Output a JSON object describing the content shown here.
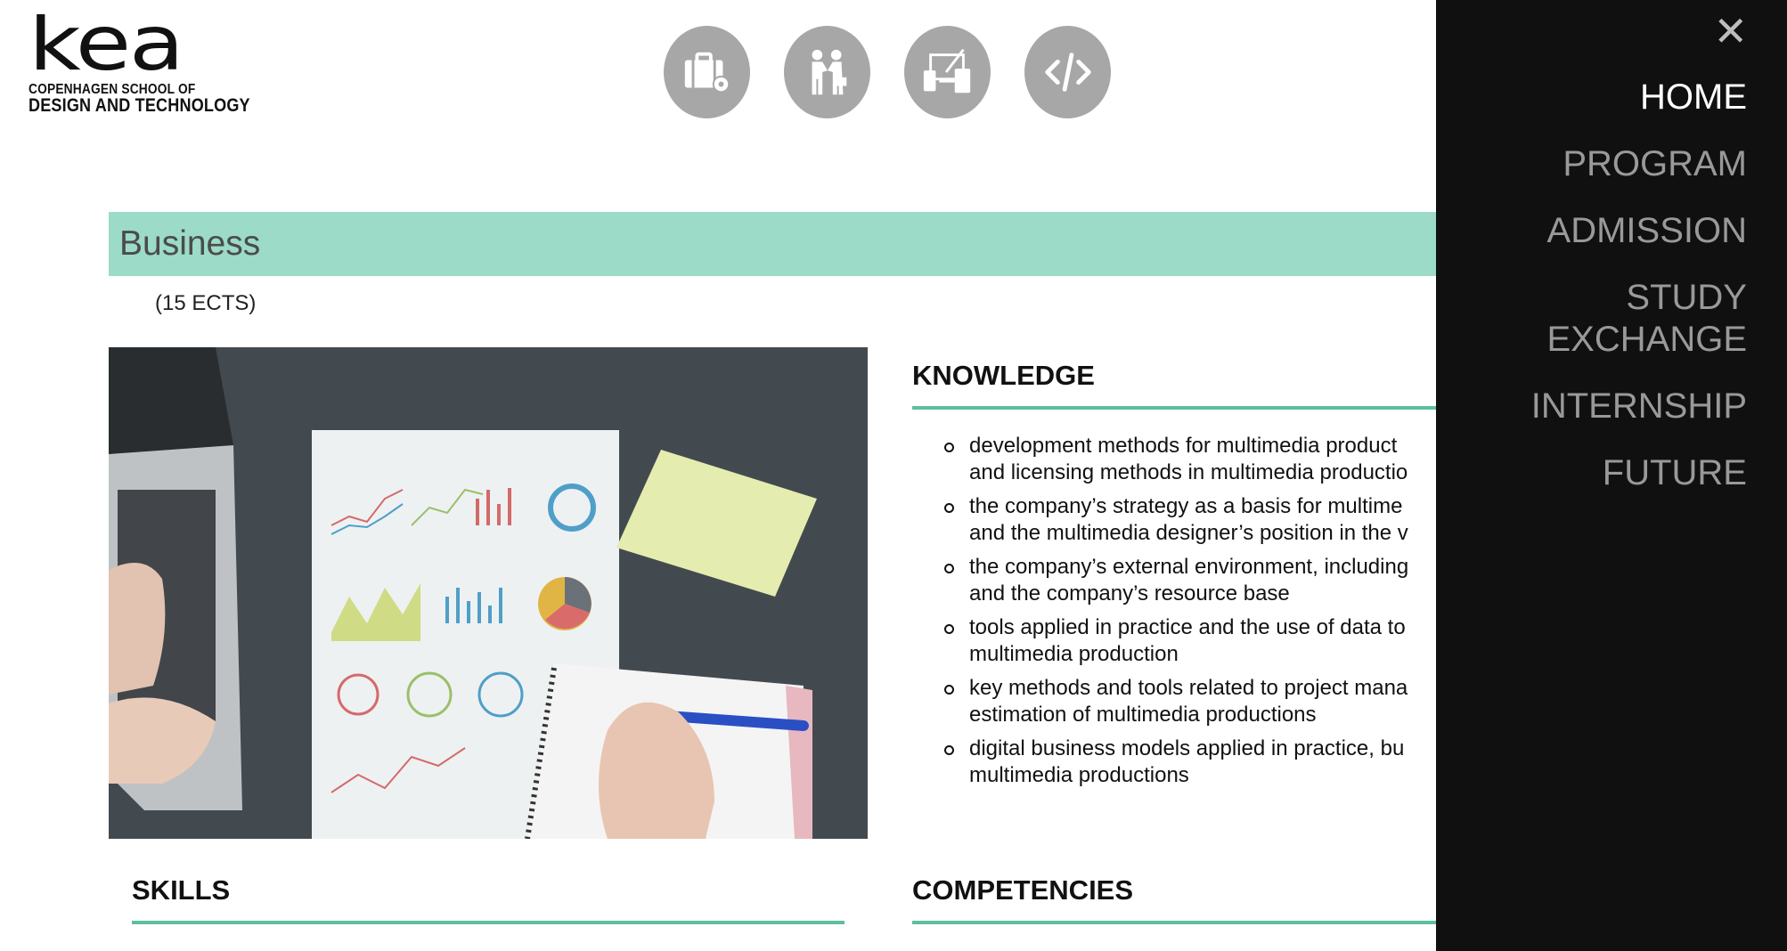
{
  "logo": {
    "word": "kea",
    "line1": "COPENHAGEN SCHOOL OF",
    "line2": "DESIGN AND TECHNOLOGY"
  },
  "top_icons": [
    {
      "name": "business-briefcase-icon"
    },
    {
      "name": "handshake-icon"
    },
    {
      "name": "multimedia-devices-icon"
    },
    {
      "name": "code-icon"
    }
  ],
  "page": {
    "title": "Business",
    "ects": "(15 ECTS)"
  },
  "knowledge": {
    "heading": "KNOWLEDGE",
    "items": [
      "development methods for multimedia product\nand licensing methods in multimedia productio",
      "the company’s strategy as a basis for multime\nand the multimedia designer’s position in the v",
      "the company’s external environment, including\nand the company’s resource base",
      "tools applied in practice and the use of data to\nmultimedia production",
      "key methods and tools related to project mana\nestimation of multimedia productions",
      "digital business models applied in practice, bu\nmultimedia productions"
    ]
  },
  "skills": {
    "heading": "SKILLS"
  },
  "competencies": {
    "heading": "COMPETENCIES"
  },
  "menu": {
    "close_label": "✕",
    "items": [
      "HOME",
      "PROGRAM",
      "ADMISSION",
      "STUDY\nEXCHANGE",
      "INTERNSHIP",
      "FUTURE"
    ],
    "active": "HOME"
  },
  "colors": {
    "accent_band": "#9bdbc7",
    "accent_rule": "#5dbf9f",
    "menu_bg": "#101010",
    "icon_circle": "#a7a7a7"
  }
}
